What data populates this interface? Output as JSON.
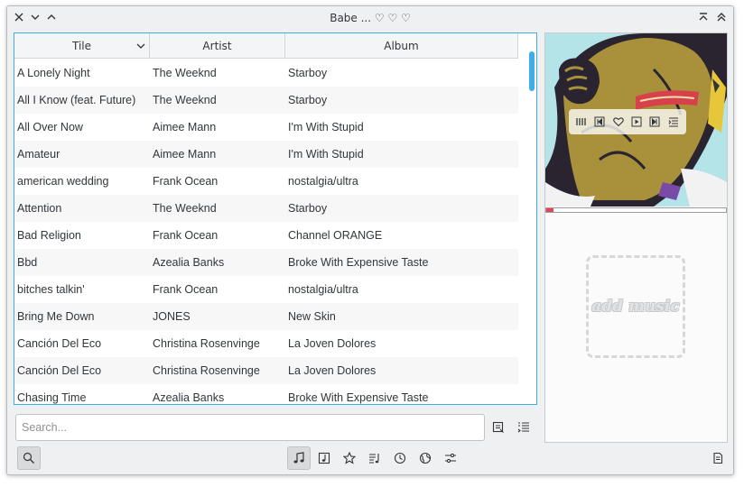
{
  "window": {
    "title": "Babe ... ♡ ♡ ♡"
  },
  "table": {
    "columns": [
      "Tile",
      "Artist",
      "Album"
    ],
    "rows": [
      {
        "title": "A Lonely Night",
        "artist": "The Weeknd",
        "album": "Starboy"
      },
      {
        "title": "All I Know (feat. Future)",
        "artist": "The Weeknd",
        "album": "Starboy"
      },
      {
        "title": "All Over Now",
        "artist": "Aimee Mann",
        "album": "I'm With Stupid"
      },
      {
        "title": "Amateur",
        "artist": "Aimee Mann",
        "album": "I'm With Stupid"
      },
      {
        "title": "american wedding",
        "artist": "Frank Ocean",
        "album": "nostalgia/ultra"
      },
      {
        "title": "Attention",
        "artist": "The Weeknd",
        "album": "Starboy"
      },
      {
        "title": "Bad Religion",
        "artist": "Frank Ocean",
        "album": "Channel ORANGE"
      },
      {
        "title": "Bbd",
        "artist": "Azealia Banks",
        "album": "Broke With Expensive Taste"
      },
      {
        "title": "bitches talkin'",
        "artist": "Frank Ocean",
        "album": "nostalgia/ultra"
      },
      {
        "title": "Bring Me Down",
        "artist": "JONES",
        "album": "New Skin"
      },
      {
        "title": "Canción Del Eco",
        "artist": "Christina Rosenvinge",
        "album": "La Joven Dolores"
      },
      {
        "title": "Canción Del Eco",
        "artist": "Christina Rosenvinge",
        "album": "La Joven Dolores"
      },
      {
        "title": "Chasing Time",
        "artist": "Azealia Banks",
        "album": "Broke With Expensive Taste"
      }
    ]
  },
  "search": {
    "placeholder": "Search..."
  },
  "player": {
    "progress": 0.04,
    "add_music_text": "add music"
  },
  "colors": {
    "accent": "#3daee9",
    "progress": "#e8425a",
    "cover_bg": "#b4e3e8"
  }
}
